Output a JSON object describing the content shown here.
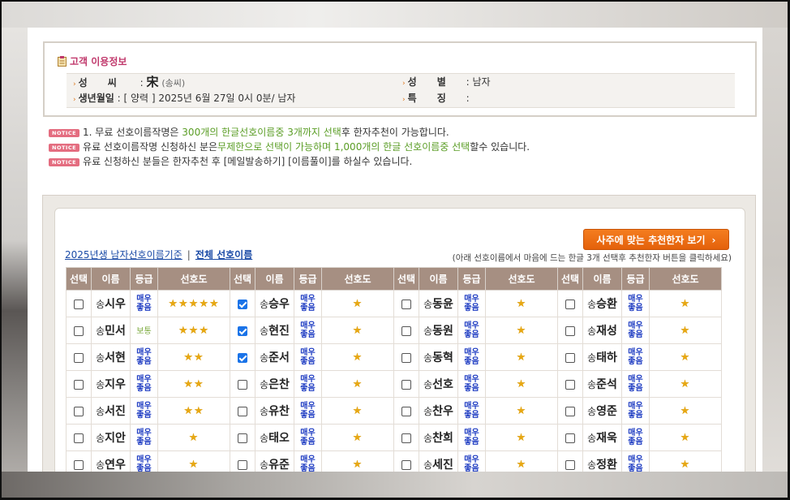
{
  "customer_info": {
    "title": "고객 이용정보",
    "surname_label": "성      씨",
    "surname_value": "宋",
    "surname_reading": "(송씨)",
    "gender_label": "성      별",
    "gender_value": ": 남자",
    "birth_label": "생년월일",
    "birth_value": ": [ 양력 ] 2025년 6월 27일 0시 0분/ 남자",
    "feature_label": "특      징",
    "feature_value": ":"
  },
  "notices": {
    "badge": "NOTICE",
    "n1_a": "1. 무료 선호이름작명은 ",
    "n1_b": "300개의 한글선호이름중 3개까지 선택",
    "n1_c": "후 한자추천이 가능합니다.",
    "n2_a": "유료 선호이름작명 신청하신 분은",
    "n2_b": "무제한으로 선택이 가능하며 1,000개의 한글 선호이름중 선택",
    "n2_c": "할수 있습니다.",
    "n3": "유료 신청하신 분들은 한자추천 후 [메일발송하기] [이름풀이]를 하실수 있습니다."
  },
  "list": {
    "recommend_button": "사주에 맞는 추천한자 보기",
    "recommend_chevron": "›",
    "link_year": "2025년생 남자선호이름기준",
    "link_separator": "|",
    "link_all": "전체 선호이름",
    "hint": "(아래 선호이름에서 마음에 드는 한글 3개 선택후 추천한자 버튼을 클릭하세요)",
    "headers": {
      "select": "선택",
      "name": "이름",
      "grade": "등급",
      "pref": "선호도"
    },
    "grade_best_1": "매우",
    "grade_best_2": "좋음",
    "grade_normal": "보통",
    "surname": "송",
    "rows": [
      [
        {
          "given": "시우",
          "checked": false,
          "grade": "best",
          "stars": "★★★★★"
        },
        {
          "given": "승우",
          "checked": true,
          "grade": "best",
          "stars": "★"
        },
        {
          "given": "동윤",
          "checked": false,
          "grade": "best",
          "stars": "★"
        },
        {
          "given": "승환",
          "checked": false,
          "grade": "best",
          "stars": "★"
        }
      ],
      [
        {
          "given": "민서",
          "checked": false,
          "grade": "normal",
          "stars": "★★★"
        },
        {
          "given": "현진",
          "checked": true,
          "grade": "best",
          "stars": "★"
        },
        {
          "given": "동원",
          "checked": false,
          "grade": "best",
          "stars": "★"
        },
        {
          "given": "재성",
          "checked": false,
          "grade": "best",
          "stars": "★"
        }
      ],
      [
        {
          "given": "서현",
          "checked": false,
          "grade": "best",
          "stars": "★★"
        },
        {
          "given": "준서",
          "checked": true,
          "grade": "best",
          "stars": "★"
        },
        {
          "given": "동혁",
          "checked": false,
          "grade": "best",
          "stars": "★"
        },
        {
          "given": "태하",
          "checked": false,
          "grade": "best",
          "stars": "★"
        }
      ],
      [
        {
          "given": "지우",
          "checked": false,
          "grade": "best",
          "stars": "★★"
        },
        {
          "given": "은찬",
          "checked": false,
          "grade": "best",
          "stars": "★"
        },
        {
          "given": "선호",
          "checked": false,
          "grade": "best",
          "stars": "★"
        },
        {
          "given": "준석",
          "checked": false,
          "grade": "best",
          "stars": "★"
        }
      ],
      [
        {
          "given": "서진",
          "checked": false,
          "grade": "best",
          "stars": "★★"
        },
        {
          "given": "유찬",
          "checked": false,
          "grade": "best",
          "stars": "★"
        },
        {
          "given": "찬우",
          "checked": false,
          "grade": "best",
          "stars": "★"
        },
        {
          "given": "영준",
          "checked": false,
          "grade": "best",
          "stars": "★"
        }
      ],
      [
        {
          "given": "지안",
          "checked": false,
          "grade": "best",
          "stars": "★"
        },
        {
          "given": "태오",
          "checked": false,
          "grade": "best",
          "stars": "★"
        },
        {
          "given": "찬희",
          "checked": false,
          "grade": "best",
          "stars": "★"
        },
        {
          "given": "재욱",
          "checked": false,
          "grade": "best",
          "stars": "★"
        }
      ],
      [
        {
          "given": "연우",
          "checked": false,
          "grade": "best",
          "stars": "★"
        },
        {
          "given": "유준",
          "checked": false,
          "grade": "best",
          "stars": "★"
        },
        {
          "given": "세진",
          "checked": false,
          "grade": "best",
          "stars": "★"
        },
        {
          "given": "정환",
          "checked": false,
          "grade": "best",
          "stars": "★"
        }
      ]
    ]
  },
  "colors": {
    "title_pink": "#c0386b",
    "notice_badge": "#e46d80",
    "highlight_green": "#5a9d25",
    "header_brown": "#a68f82",
    "button_orange": "#f47d1f",
    "grade_blue": "#1e3cc2",
    "star_gold": "#e8a812"
  }
}
